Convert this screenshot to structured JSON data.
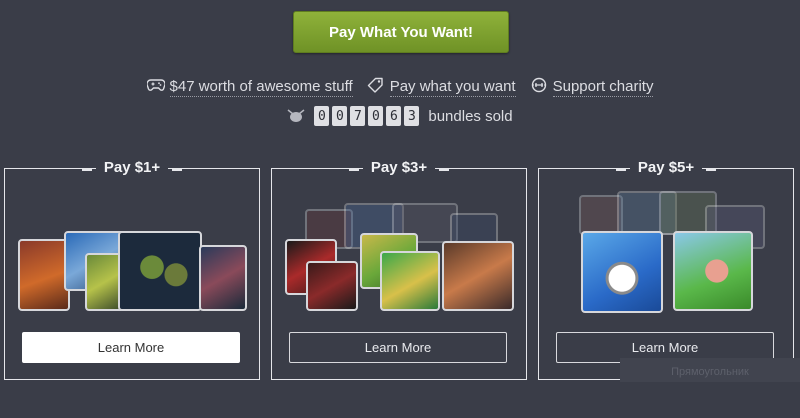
{
  "cta": {
    "label": "Pay What You Want!"
  },
  "features": [
    {
      "icon": "gamepad-icon",
      "label": "$47 worth of awesome stuff"
    },
    {
      "icon": "tag-icon",
      "label": "Pay what you want"
    },
    {
      "icon": "charity-icon",
      "label": "Support charity"
    }
  ],
  "sold": {
    "digits": [
      "0",
      "0",
      "7",
      "0",
      "6",
      "3"
    ],
    "label": "bundles sold"
  },
  "tiers": [
    {
      "title": "Pay $1+",
      "button": "Learn More"
    },
    {
      "title": "Pay $3+",
      "button": "Learn More"
    },
    {
      "title": "Pay $5+",
      "button": "Learn More"
    }
  ],
  "watermark": "Прямоугольник",
  "colors": {
    "background": "#3a3d48",
    "cta": "#7ea331",
    "text": "#e9eaee"
  }
}
